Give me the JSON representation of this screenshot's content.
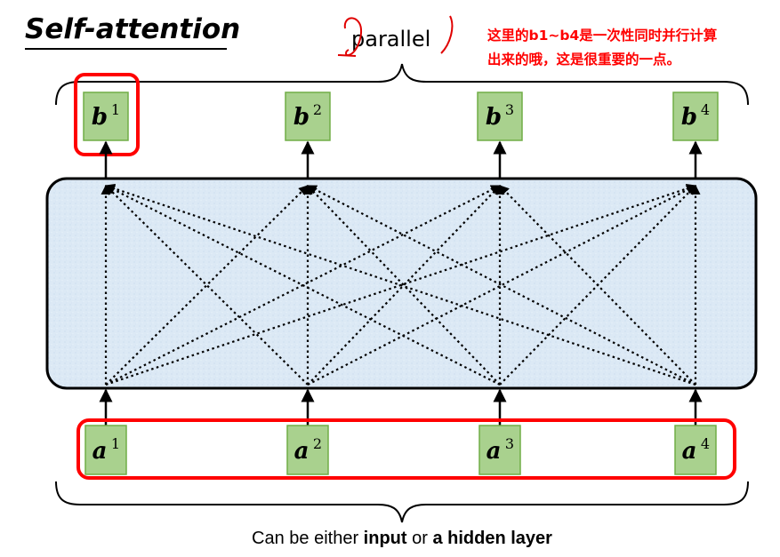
{
  "title": "Self-attention",
  "annotation": {
    "handwritten": "parallel",
    "note_line1": "这里的b1~b4是一次性同时并行计算",
    "note_line2": "出来的哦，这是很重要的一点。"
  },
  "outputs": [
    {
      "var": "b",
      "sup": "1"
    },
    {
      "var": "b",
      "sup": "2"
    },
    {
      "var": "b",
      "sup": "3"
    },
    {
      "var": "b",
      "sup": "4"
    }
  ],
  "inputs": [
    {
      "var": "a",
      "sup": "1"
    },
    {
      "var": "a",
      "sup": "2"
    },
    {
      "var": "a",
      "sup": "3"
    },
    {
      "var": "a",
      "sup": "4"
    }
  ],
  "caption": {
    "part1": "Can be either ",
    "bold1": "input",
    "part2": " or ",
    "bold2": "a hidden layer"
  },
  "colors": {
    "box_fill": "#a9d18e",
    "box_stroke": "#70ad47",
    "panel_fill": "#dce9f5",
    "highlight": "#ff0000"
  }
}
